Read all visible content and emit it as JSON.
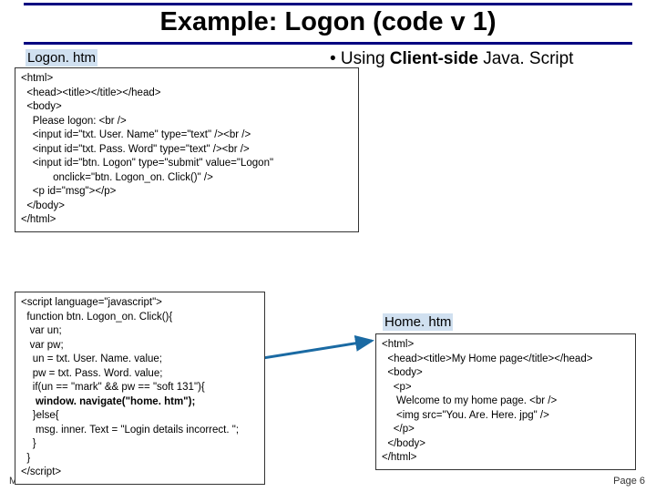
{
  "title": "Example: Logon (code v 1)",
  "labels": {
    "logon": "Logon. htm",
    "home": "Home. htm"
  },
  "bullet": {
    "prefix": "•  Using ",
    "bold": "Client-side",
    "suffix": " Java. Script"
  },
  "code1": {
    "l0": "<html>",
    "l1": "  <head><title></title></head>",
    "l2": "  <body>",
    "l3": "    Please logon: <br />",
    "l4": "    <input id=\"txt. User. Name\" type=\"text\" /><br />",
    "l5": "    <input id=\"txt. Pass. Word\" type=\"text\" /><br />",
    "l6": "    <input id=\"btn. Logon\" type=\"submit\" value=\"Logon\"",
    "l7": "           onclick=\"btn. Logon_on. Click()\" />",
    "l8": "    <p id=\"msg\"></p>",
    "l9": "  </body>",
    "l10": "</html>"
  },
  "code2": {
    "l0": "<script language=\"javascript\">",
    "l1": "  function btn. Logon_on. Click(){",
    "l2": "   var un;",
    "l3": "   var pw;",
    "l4": "    un = txt. User. Name. value;",
    "l5": "    pw = txt. Pass. Word. value;",
    "l6": "    if(un == \"mark\" && pw == \"soft 131\"){",
    "l7_bold": "     window. navigate(\"home. htm\");",
    "l8": "    }else{",
    "l9": "     msg. inner. Text = \"Login details incorrect. \";",
    "l10": "    }",
    "l11": "  }",
    "l12": "</script>"
  },
  "code3": {
    "l0": "<html>",
    "l1": "  <head><title>My Home page</title></head>",
    "l2": "  <body>",
    "l3": "    <p>",
    "l4": "     Welcome to my home page. <br />",
    "l5": "     <img src=\"You. Are. Here. jpg\" />",
    "l6": "    </p>",
    "l7": "  </body>",
    "l8": "</html>"
  },
  "footer": {
    "left": "Mark Dixon",
    "right": "Page 6"
  }
}
